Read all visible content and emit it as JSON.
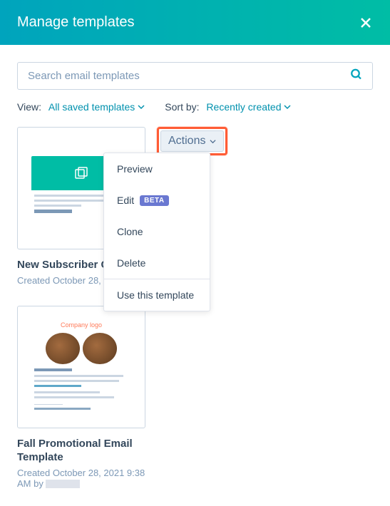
{
  "header": {
    "title": "Manage templates"
  },
  "search": {
    "placeholder": "Search email templates"
  },
  "view": {
    "label": "View:",
    "selected": "All saved templates"
  },
  "sort": {
    "label": "Sort by:",
    "selected": "Recently created"
  },
  "actions": {
    "button": "Actions",
    "menu": {
      "preview": "Preview",
      "edit": "Edit",
      "beta": "BETA",
      "clone": "Clone",
      "delete": "Delete",
      "use": "Use this template"
    }
  },
  "templates": [
    {
      "title": "New Subscriber Co",
      "meta_prefix": "Created October 28, 2"
    },
    {
      "title": "Fall Promotional Email Template",
      "meta_prefix": "Created October 28, 2021 9:38 AM by ",
      "company_logo": "Company logo"
    }
  ]
}
